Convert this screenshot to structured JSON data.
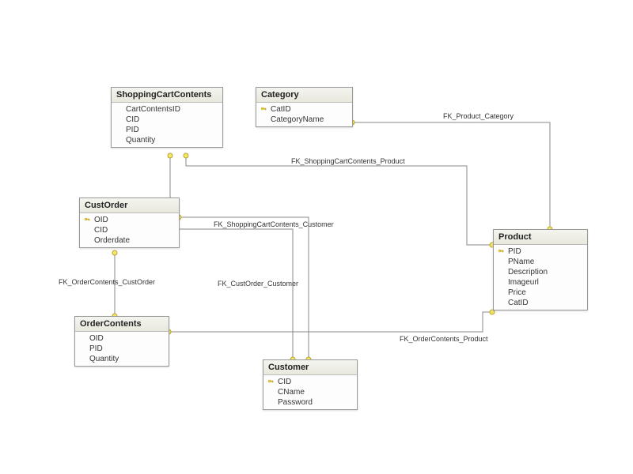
{
  "entities": {
    "shoppingCartContents": {
      "title": "ShoppingCartContents",
      "fields": [
        {
          "name": "CartContentsID",
          "pk": false
        },
        {
          "name": "CID",
          "pk": false
        },
        {
          "name": "PID",
          "pk": false
        },
        {
          "name": "Quantity",
          "pk": false
        }
      ]
    },
    "category": {
      "title": "Category",
      "fields": [
        {
          "name": "CatID",
          "pk": true
        },
        {
          "name": "CategoryName",
          "pk": false
        }
      ]
    },
    "custOrder": {
      "title": "CustOrder",
      "fields": [
        {
          "name": "OID",
          "pk": true
        },
        {
          "name": "CID",
          "pk": false
        },
        {
          "name": "Orderdate",
          "pk": false
        }
      ]
    },
    "product": {
      "title": "Product",
      "fields": [
        {
          "name": "PID",
          "pk": true
        },
        {
          "name": "PName",
          "pk": false
        },
        {
          "name": "Description",
          "pk": false
        },
        {
          "name": "Imageurl",
          "pk": false
        },
        {
          "name": "Price",
          "pk": false
        },
        {
          "name": "CatID",
          "pk": false
        }
      ]
    },
    "orderContents": {
      "title": "OrderContents",
      "fields": [
        {
          "name": "OID",
          "pk": false
        },
        {
          "name": "PID",
          "pk": false
        },
        {
          "name": "Quantity",
          "pk": false
        }
      ]
    },
    "customer": {
      "title": "Customer",
      "fields": [
        {
          "name": "CID",
          "pk": true
        },
        {
          "name": "CName",
          "pk": false
        },
        {
          "name": "Password",
          "pk": false
        }
      ]
    }
  },
  "relationships": {
    "fk_product_category": "FK_Product_Category",
    "fk_shoppingcartcontents_product": "FK_ShoppingCartContents_Product",
    "fk_shoppingcartcontents_customer": "FK_ShoppingCartContents_Customer",
    "fk_custorder_customer": "FK_CustOrder_Customer",
    "fk_ordercontents_custorder": "FK_OrderContents_CustOrder",
    "fk_ordercontents_product": "FK_OrderContents_Product"
  }
}
